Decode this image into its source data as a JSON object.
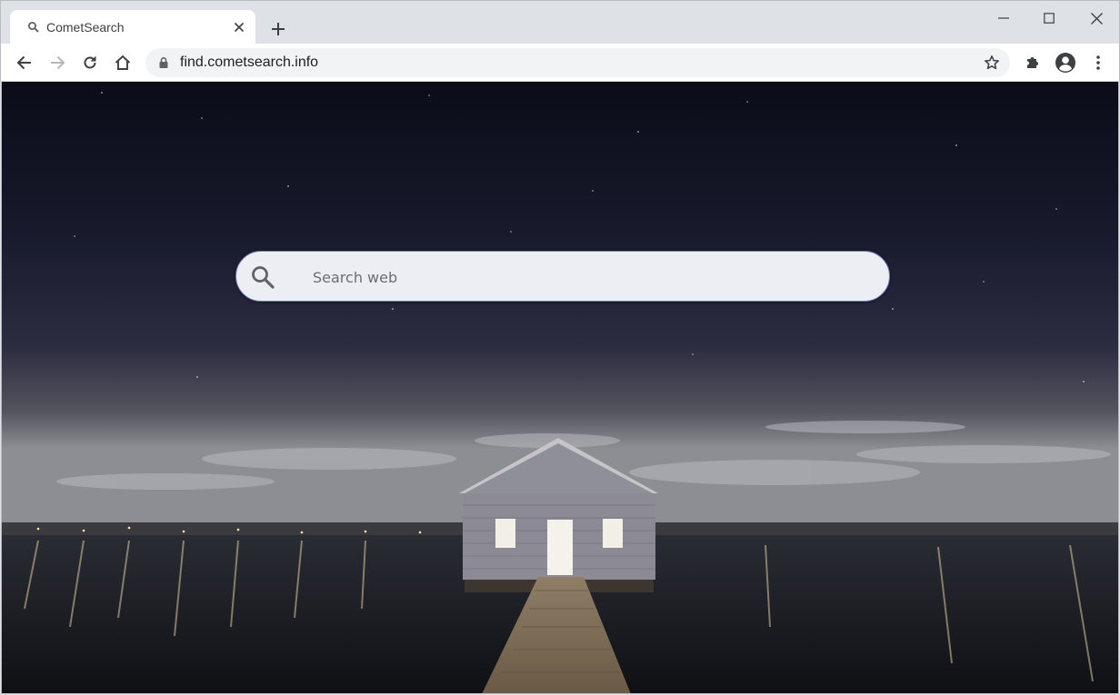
{
  "browser": {
    "tab": {
      "title": "CometSearch",
      "favicon": "search-icon"
    },
    "new_tab_icon": "plus-icon",
    "window_controls": [
      "minimize-icon",
      "maximize-icon",
      "close-icon"
    ],
    "toolbar": {
      "back_icon": "arrow-left-icon",
      "forward_icon": "arrow-right-icon",
      "reload_icon": "reload-icon",
      "home_icon": "home-icon",
      "url": "find.cometsearch.info",
      "bookmark_icon": "star-icon",
      "extensions_icon": "puzzle-icon",
      "profile_icon": "account-icon",
      "menu_icon": "kebab-menu-icon"
    }
  },
  "page": {
    "search": {
      "placeholder": "Search web",
      "icon": "search-icon"
    },
    "colors": {
      "accent_border": "#6c7ab8",
      "search_bg": "#eceef3"
    }
  }
}
